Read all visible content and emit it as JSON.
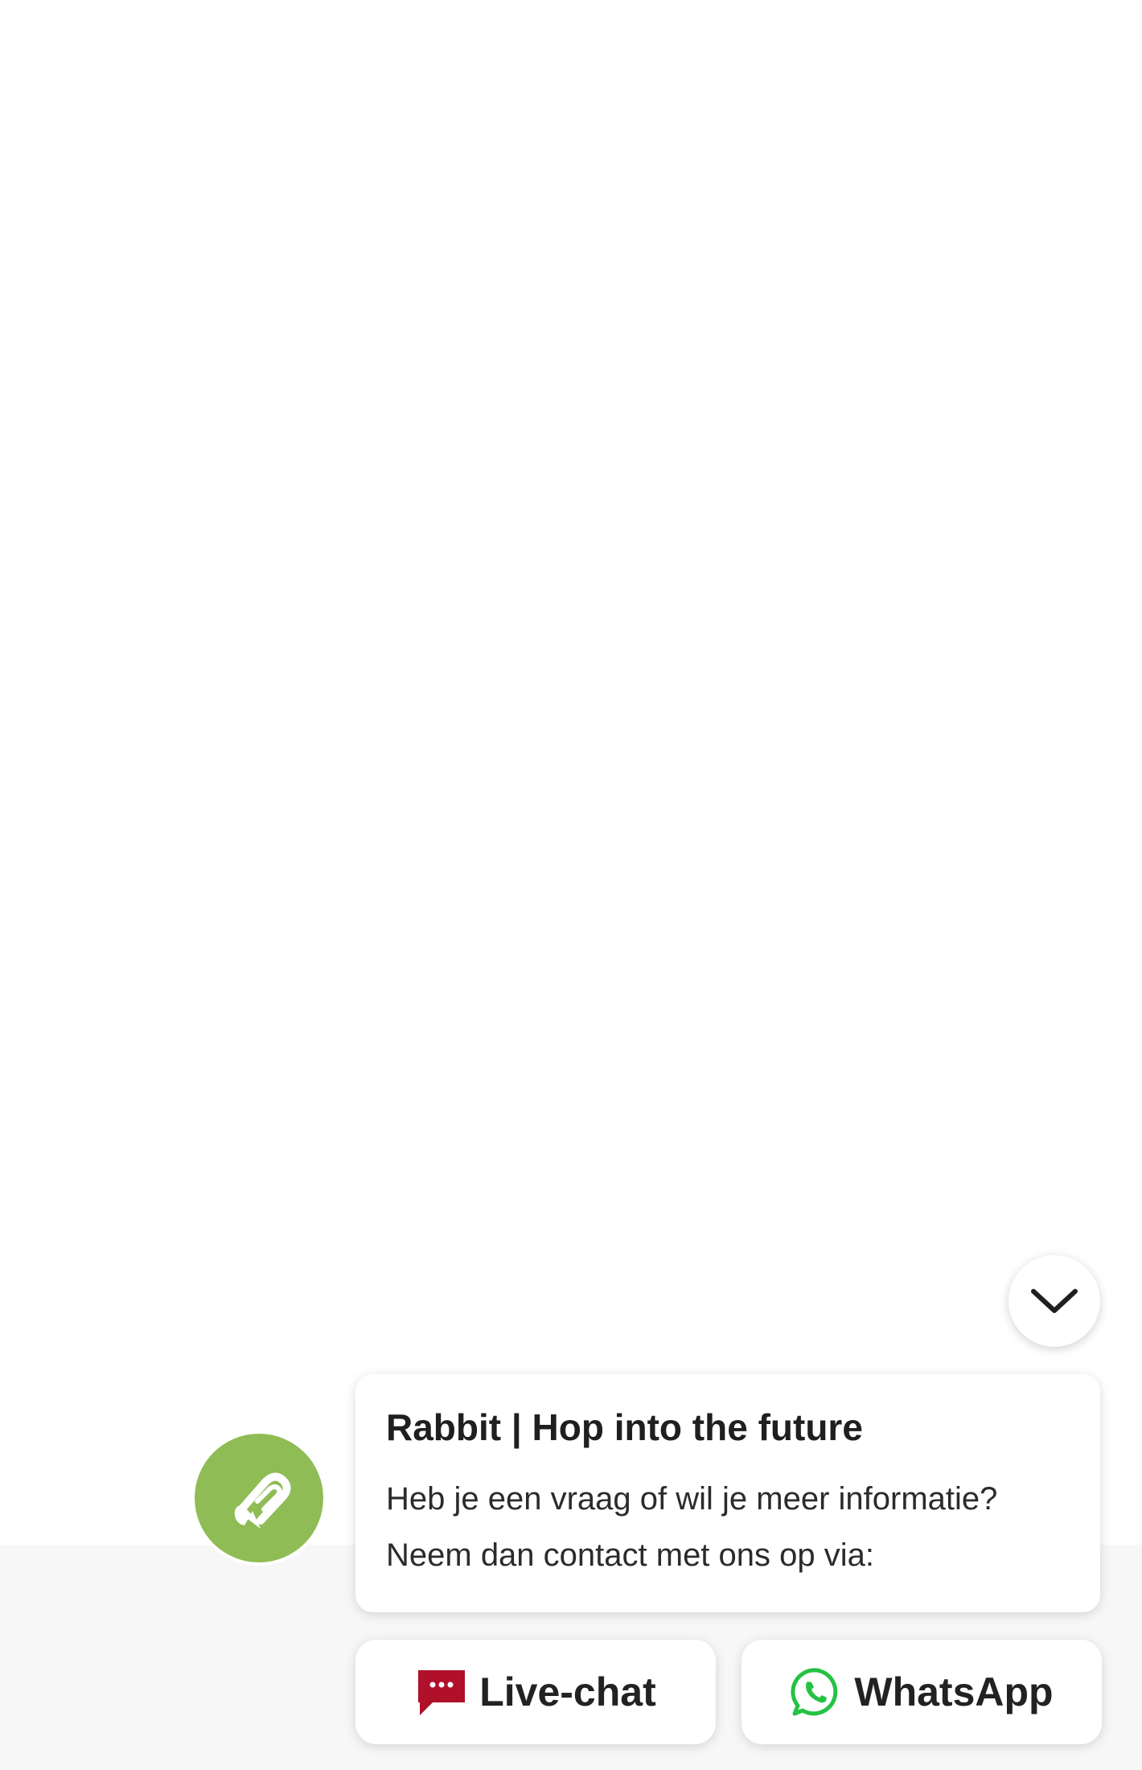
{
  "widget": {
    "title": "Rabbit | Hop into the future",
    "message_lines": [
      "Heb je een vraag of wil je meer informatie?",
      "Neem dan contact met ons op via:"
    ],
    "buttons": {
      "livechat_label": "Live-chat",
      "whatsapp_label": "WhatsApp"
    },
    "icons": {
      "collapse": "chevron-down-icon",
      "avatar": "brand-logo",
      "livechat": "chat-bubble-icon",
      "whatsapp": "whatsapp-icon"
    },
    "colors": {
      "avatar_bg": "#8fbc55",
      "livechat_icon": "#b0102a",
      "whatsapp_icon": "#25c243",
      "footer_band": "#f7f7f7"
    }
  }
}
